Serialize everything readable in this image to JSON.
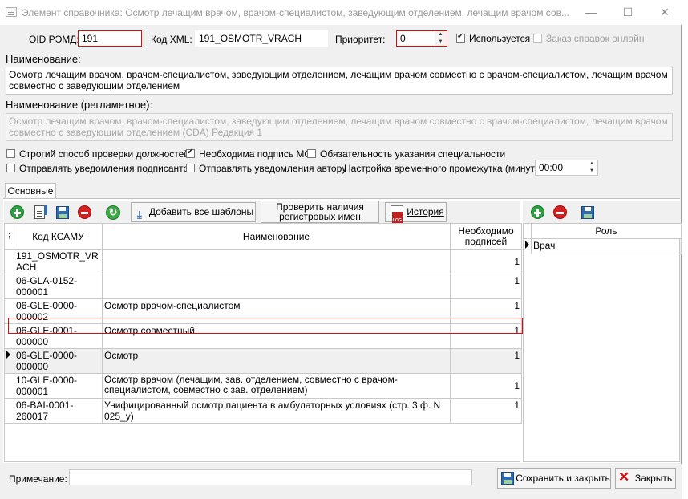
{
  "window": {
    "title": "Элемент справочника: Осмотр лечащим врачом, врачом-специалистом, заведующим отделением, лечащим врачом сов...",
    "minimize": "—",
    "maximize": "☐",
    "close": "✕"
  },
  "header": {
    "oid_label": "OID РЭМД:",
    "oid_value": "191",
    "xml_label": "Код XML:",
    "xml_value": "191_OSMOTR_VRACH",
    "priority_label": "Приоритет:",
    "priority_value": "0",
    "used_label": "Используется",
    "order_label": "Заказ справок онлайн"
  },
  "name": {
    "label": "Наименование:",
    "value": "Осмотр лечащим врачом, врачом-специалистом, заведующим отделением, лечащим врачом совместно с врачом-специалистом, лечащим врачом совместно с заведующим отделением"
  },
  "reg_name": {
    "label": "Наименование (регламетное):",
    "value": "Осмотр лечащим врачом, врачом-специалистом, заведующим отделением, лечащим врачом совместно с врачом-специалистом, лечащим врачом совместно с заведующим отделением (CDA) Редакция 1"
  },
  "options": {
    "strict": "Строгий способ проверки должностей",
    "mo_sign": "Необходима подпись МО",
    "specialty": "Обязательность указания специальности",
    "notify_signers": "Отправлять уведомления подписантов",
    "notify_author": "Отправлять уведомления автору",
    "time_label": "Настройка временного промежутка (минуты):",
    "time_value": "00:00"
  },
  "tabs": [
    "Основные"
  ],
  "toolbar": {
    "add_all": "Добавить все шаблоны",
    "check_line1": "Проверить наличия",
    "check_line2": "регистровых имен",
    "history": "История"
  },
  "table": {
    "headers": [
      "Код КСАМУ",
      "Наименование",
      "Необходимо подписей"
    ],
    "rows": [
      {
        "code": "191_OSMOTR_VRACH",
        "name": "",
        "count": "1"
      },
      {
        "code": "06-GLA-0152-000001",
        "name": "",
        "count": "1"
      },
      {
        "code": "06-GLE-0000-000002",
        "name": "Осмотр врачом-специалистом",
        "count": "1"
      },
      {
        "code": "06-GLE-0001-000000",
        "name": "Осмотр совместный",
        "count": "1"
      },
      {
        "code": "06-GLE-0000-000000",
        "name": "Осмотр",
        "count": "1"
      },
      {
        "code": "10-GLE-0000-000001",
        "name": "Осмотр врачом (лечащим, зав. отделением, совместно с врачом-специалистом, совместно с зав. отделением)",
        "count": "1"
      },
      {
        "code": "06-BAI-0001-260017",
        "name": "Унифицированный осмотр пациента в амбулаторных условиях (стр. 3 ф. N 025_у)",
        "count": "1"
      }
    ]
  },
  "roles": {
    "header": "Роль",
    "rows": [
      "Врач"
    ]
  },
  "footer": {
    "note_label": "Примечание:",
    "note_value": "",
    "save_close": "Сохранить и закрыть",
    "close": "Закрыть"
  }
}
